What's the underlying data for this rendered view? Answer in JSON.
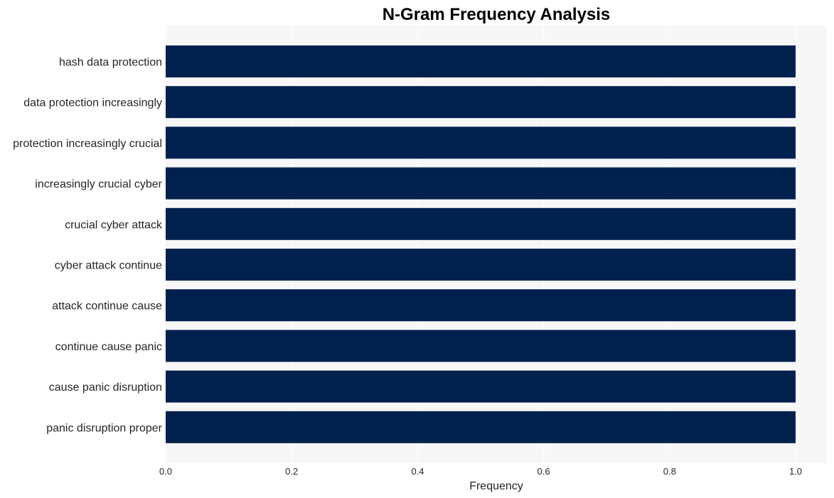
{
  "chart_data": {
    "type": "bar",
    "orientation": "horizontal",
    "title": "N-Gram Frequency Analysis",
    "xlabel": "Frequency",
    "ylabel": "",
    "categories": [
      "hash data protection",
      "data protection increasingly",
      "protection increasingly crucial",
      "increasingly crucial cyber",
      "crucial cyber attack",
      "cyber attack continue",
      "attack continue cause",
      "continue cause panic",
      "cause panic disruption",
      "panic disruption proper"
    ],
    "values": [
      1,
      1,
      1,
      1,
      1,
      1,
      1,
      1,
      1,
      1
    ],
    "xlim": [
      0,
      1.05
    ],
    "xticks": [
      0.0,
      0.2,
      0.4,
      0.6,
      0.8,
      1.0
    ],
    "xtick_labels": [
      "0.0",
      "0.2",
      "0.4",
      "0.6",
      "0.8",
      "1.0"
    ],
    "grid": true,
    "legend": "none",
    "colors": {
      "bar": "#00214d",
      "plot_background": "#f7f7f7",
      "grid": "#ffffff"
    }
  }
}
